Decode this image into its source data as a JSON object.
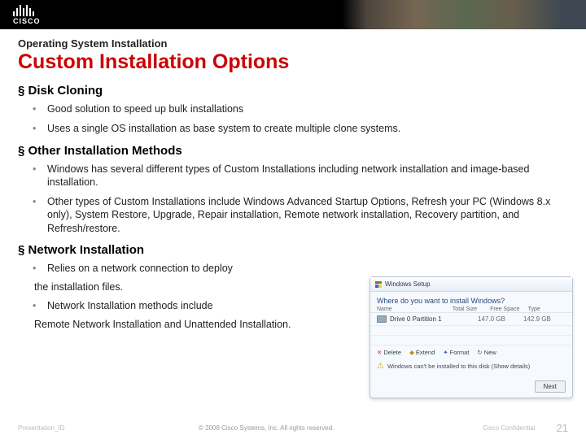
{
  "logo_text": "CISCO",
  "pretitle": "Operating System Installation",
  "title": "Custom Installation Options",
  "sections": [
    {
      "head": "Disk Cloning",
      "bullets": [
        "Good solution to speed up bulk installations",
        "Uses a single OS installation as base system to create multiple clone systems."
      ]
    },
    {
      "head": "Other Installation Methods",
      "bullets": [
        "Windows has several different types of Custom Installations including network installation and image-based installation.",
        "Other types of Custom Installations include Windows Advanced Startup Options, Refresh your PC (Windows 8.x only), System Restore, Upgrade, Repair installation, Remote network installation, Recovery partition, and Refresh/restore."
      ]
    }
  ],
  "network_section": {
    "head": "Network Installation",
    "b1": "Relies on a network connection to deploy",
    "t1": "the installation files.",
    "b2": "Network Installation methods include",
    "t2": "Remote Network Installation and Unattended Installation."
  },
  "win": {
    "title": "Windows Setup",
    "question": "Where do you want to install Windows?",
    "cols": [
      "Name",
      "Total Size",
      "Free Space",
      "Type"
    ],
    "row": {
      "label": "Drive 0 Partition 1",
      "size": "147.0 GB",
      "free": "142.9 GB",
      "type": ""
    },
    "icons": [
      "Delete",
      "Extend",
      "Format",
      "New"
    ],
    "warn": "Windows can't be installed to this disk (Show details)",
    "next": "Next"
  },
  "footer": {
    "left": "Presentation_ID",
    "center": "© 2008 Cisco Systems, Inc. All rights reserved.",
    "conf": "Cisco Confidential",
    "page": "21"
  }
}
